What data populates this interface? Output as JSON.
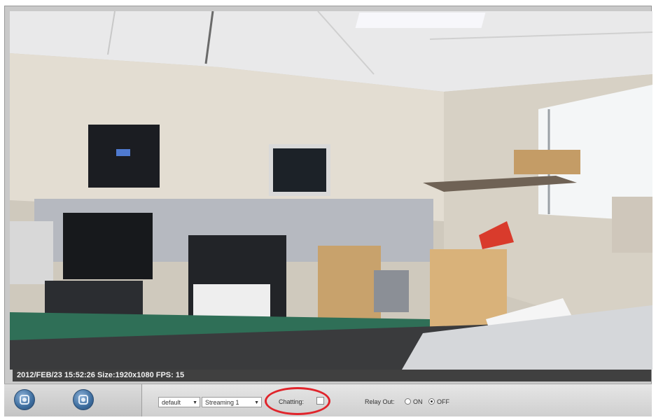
{
  "status_overlay": {
    "text": "2012/FEB/23 15:52:26 Size:1920x1080 FPS: 15"
  },
  "toolbar": {
    "left_buttons": [
      {
        "icon": "camera-snapshot-icon"
      },
      {
        "icon": "record-icon"
      }
    ],
    "profile_select": {
      "value": "default"
    },
    "stream_select": {
      "value": "Streaming 1"
    },
    "chatting": {
      "label": "Chatting:",
      "checked": false
    },
    "relay_out": {
      "label": "Relay Out:",
      "on_label": "ON",
      "off_label": "OFF",
      "selected": "OFF"
    }
  },
  "colors": {
    "highlight_ring": "#e0242b",
    "toolbar_bg": "#d6d6d6",
    "overlay_bg": "#404040"
  }
}
